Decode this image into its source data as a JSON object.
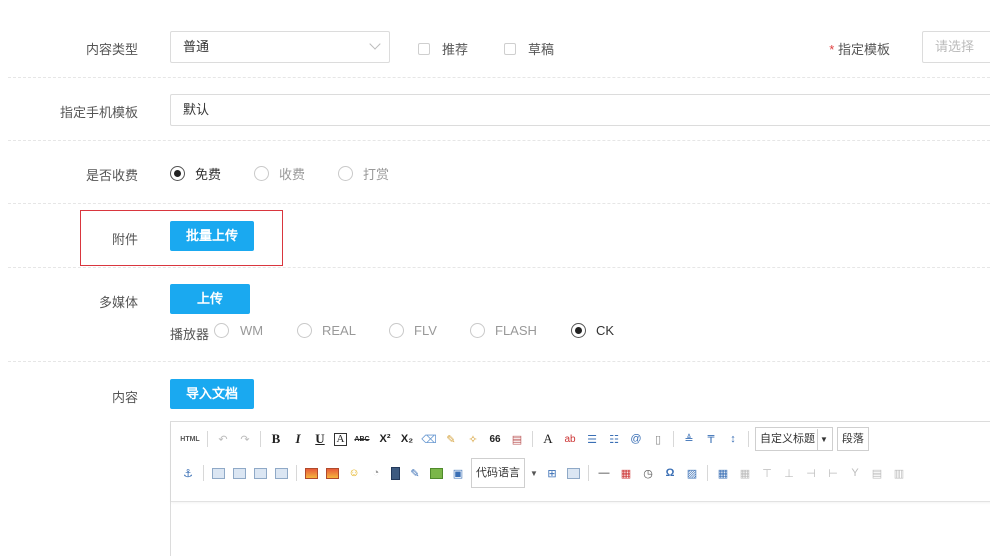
{
  "content_type": {
    "label": "内容类型",
    "value": "普通",
    "recommend_label": "推荐",
    "draft_label": "草稿",
    "template_required_mark": "*",
    "template_label": "指定模板",
    "template_placeholder": "请选择"
  },
  "mobile_template": {
    "label": "指定手机模板",
    "value": "默认"
  },
  "charge": {
    "label": "是否收费",
    "options": [
      "免费",
      "收费",
      "打赏"
    ],
    "selected": "免费"
  },
  "attachment": {
    "label": "附件",
    "upload_button": "批量上传"
  },
  "multimedia": {
    "label": "多媒体",
    "upload_button": "上传",
    "player_label": "播放器",
    "players": [
      "WM",
      "REAL",
      "FLV",
      "FLASH",
      "CK"
    ],
    "selected_player": "CK"
  },
  "content": {
    "label": "内容",
    "import_button": "导入文档",
    "toolbar": {
      "html_label": "HTML",
      "bold": "B",
      "italic": "I",
      "underline": "U",
      "font_border": "A",
      "strike": "ABC",
      "superscript": "X²",
      "subscript": "X₂",
      "quote": "66",
      "font_color": "A",
      "custom_heading": "自定义标题",
      "paragraph": "段落",
      "code_language": "代码语言",
      "omega": "Ω",
      "dash": "—"
    }
  },
  "colors": {
    "primary_button": "#1aa9f0",
    "highlight_border": "#d9363e",
    "required_mark": "#e04040"
  }
}
